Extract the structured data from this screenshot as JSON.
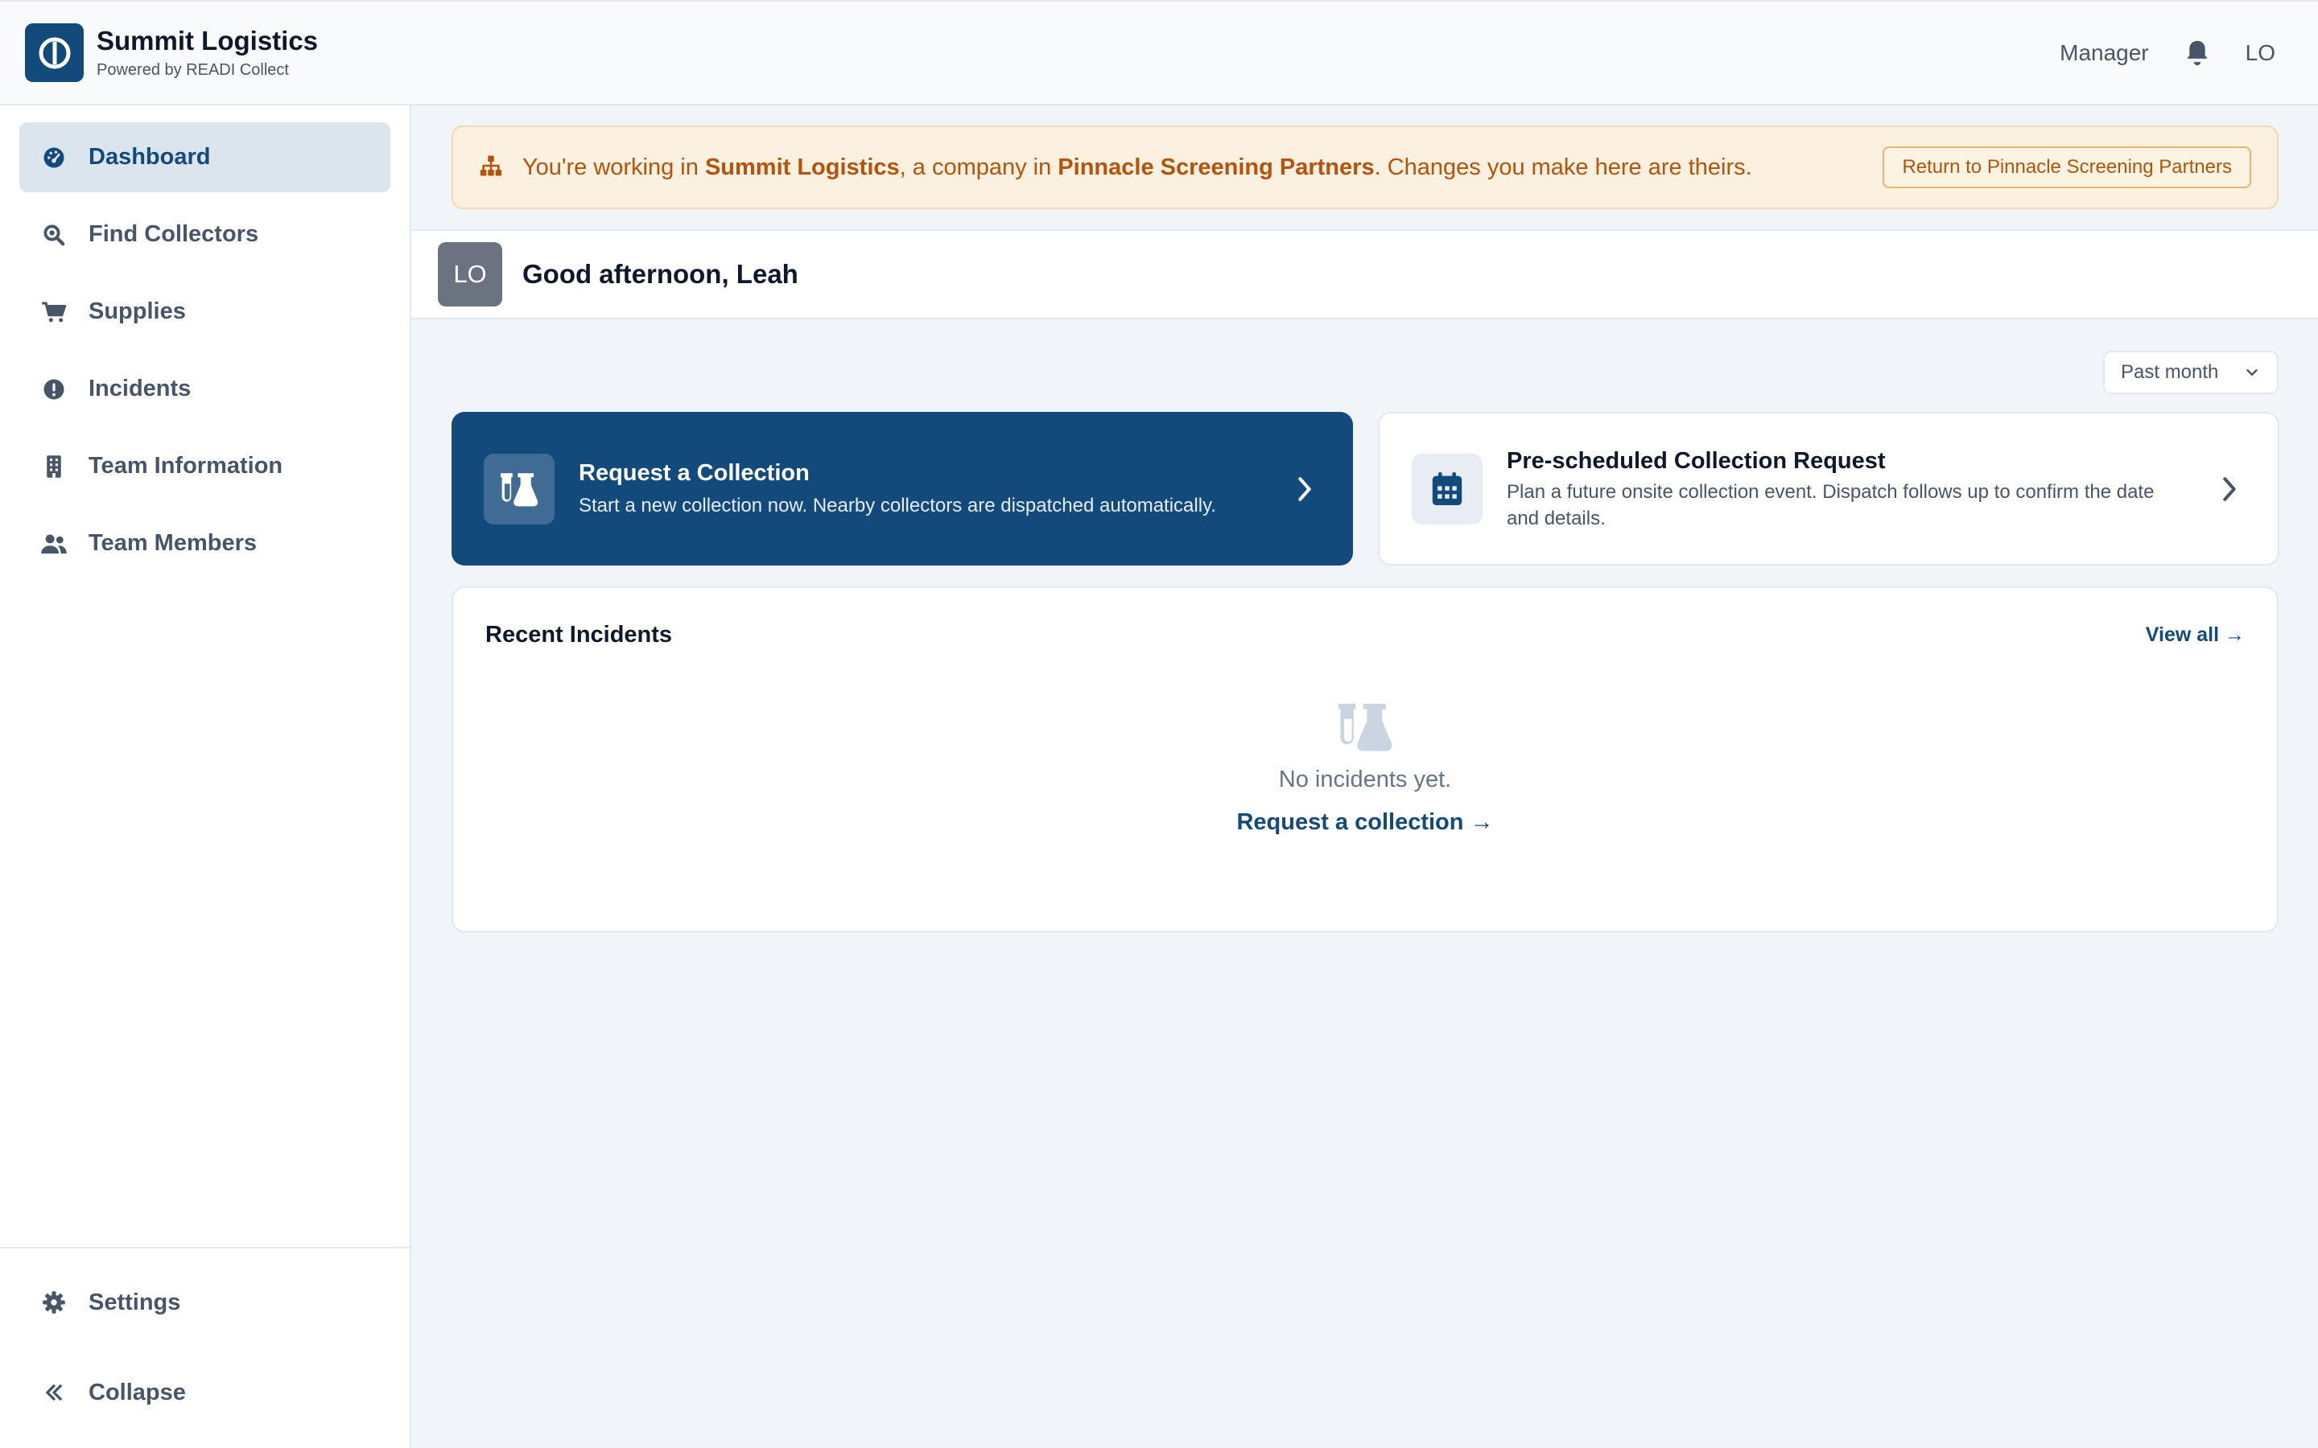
{
  "header": {
    "app_title": "Summit Logistics",
    "app_subtitle": "Powered by READI Collect",
    "role": "Manager",
    "user_initials": "LO"
  },
  "sidebar": {
    "items": [
      {
        "label": "Dashboard",
        "icon": "gauge-icon",
        "active": true
      },
      {
        "label": "Find Collectors",
        "icon": "search-icon",
        "active": false
      },
      {
        "label": "Supplies",
        "icon": "cart-icon",
        "active": false
      },
      {
        "label": "Incidents",
        "icon": "alert-icon",
        "active": false
      },
      {
        "label": "Team Information",
        "icon": "building-icon",
        "active": false
      },
      {
        "label": "Team Members",
        "icon": "users-icon",
        "active": false
      }
    ],
    "settings_label": "Settings",
    "collapse_label": "Collapse"
  },
  "banner": {
    "prefix": "You're working in ",
    "company": "Summit Logistics",
    "middle": ", a company in ",
    "parent": "Pinnacle Screening Partners",
    "suffix": ". Changes you make here are theirs.",
    "button_label": "Return to Pinnacle Screening Partners"
  },
  "greeting": {
    "initials": "LO",
    "text": "Good afternoon, Leah"
  },
  "period_filter": {
    "selected": "Past month"
  },
  "cards": {
    "request": {
      "title": "Request a Collection",
      "description": "Start a new collection now. Nearby collectors are dispatched automatically."
    },
    "prescheduled": {
      "title": "Pre-scheduled Collection Request",
      "description": "Plan a future onsite collection event. Dispatch follows up to confirm the date and details."
    }
  },
  "recent_incidents": {
    "title": "Recent Incidents",
    "view_all": "View all →",
    "empty_text": "No incidents yet.",
    "empty_link": "Request a collection →"
  },
  "colors": {
    "brand": "#134a7c",
    "banner_bg": "#fcf0e0",
    "banner_text": "#b45309",
    "active_nav_bg": "#dce4ee"
  }
}
